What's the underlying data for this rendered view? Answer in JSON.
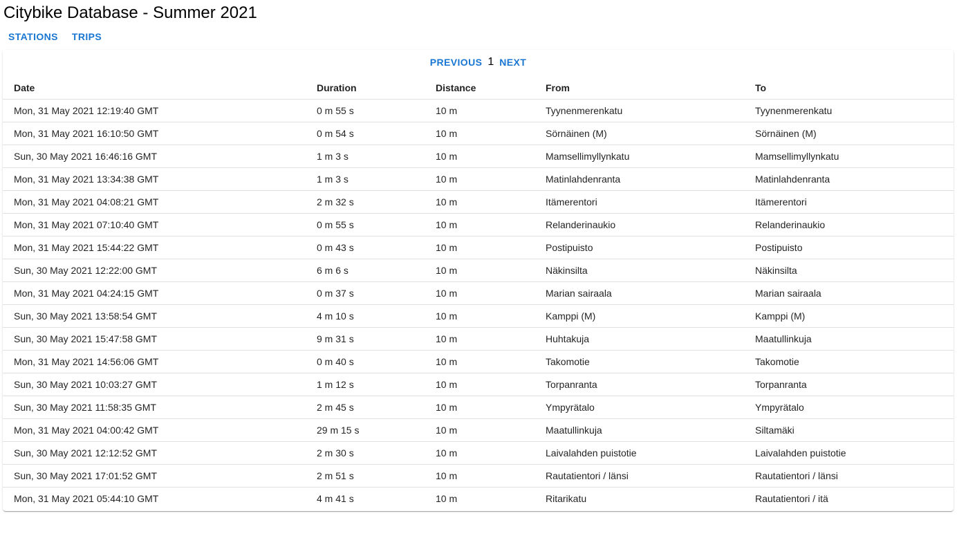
{
  "app": {
    "title": "Citybike Database - Summer 2021"
  },
  "nav": {
    "stations_label": "STATIONS",
    "trips_label": "TRIPS"
  },
  "pagination": {
    "previous_label": "PREVIOUS",
    "current_page": "1",
    "next_label": "NEXT"
  },
  "table": {
    "headers": {
      "date": "Date",
      "duration": "Duration",
      "distance": "Distance",
      "from": "From",
      "to": "To"
    },
    "rows": [
      {
        "date": "Mon, 31 May 2021 12:19:40 GMT",
        "duration": "0 m 55 s",
        "distance": "10 m",
        "from": "Tyynenmerenkatu",
        "to": "Tyynenmerenkatu"
      },
      {
        "date": "Mon, 31 May 2021 16:10:50 GMT",
        "duration": "0 m 54 s",
        "distance": "10 m",
        "from": "Sörnäinen (M)",
        "to": "Sörnäinen (M)"
      },
      {
        "date": "Sun, 30 May 2021 16:46:16 GMT",
        "duration": "1 m 3 s",
        "distance": "10 m",
        "from": "Mamsellimyllynkatu",
        "to": "Mamsellimyllynkatu"
      },
      {
        "date": "Mon, 31 May 2021 13:34:38 GMT",
        "duration": "1 m 3 s",
        "distance": "10 m",
        "from": "Matinlahdenranta",
        "to": "Matinlahdenranta"
      },
      {
        "date": "Mon, 31 May 2021 04:08:21 GMT",
        "duration": "2 m 32 s",
        "distance": "10 m",
        "from": "Itämerentori",
        "to": "Itämerentori"
      },
      {
        "date": "Mon, 31 May 2021 07:10:40 GMT",
        "duration": "0 m 55 s",
        "distance": "10 m",
        "from": "Relanderinaukio",
        "to": "Relanderinaukio"
      },
      {
        "date": "Mon, 31 May 2021 15:44:22 GMT",
        "duration": "0 m 43 s",
        "distance": "10 m",
        "from": "Postipuisto",
        "to": "Postipuisto"
      },
      {
        "date": "Sun, 30 May 2021 12:22:00 GMT",
        "duration": "6 m 6 s",
        "distance": "10 m",
        "from": "Näkinsilta",
        "to": "Näkinsilta"
      },
      {
        "date": "Mon, 31 May 2021 04:24:15 GMT",
        "duration": "0 m 37 s",
        "distance": "10 m",
        "from": "Marian sairaala",
        "to": "Marian sairaala"
      },
      {
        "date": "Sun, 30 May 2021 13:58:54 GMT",
        "duration": "4 m 10 s",
        "distance": "10 m",
        "from": "Kamppi (M)",
        "to": "Kamppi (M)"
      },
      {
        "date": "Sun, 30 May 2021 15:47:58 GMT",
        "duration": "9 m 31 s",
        "distance": "10 m",
        "from": "Huhtakuja",
        "to": "Maatullinkuja"
      },
      {
        "date": "Mon, 31 May 2021 14:56:06 GMT",
        "duration": "0 m 40 s",
        "distance": "10 m",
        "from": "Takomotie",
        "to": "Takomotie"
      },
      {
        "date": "Sun, 30 May 2021 10:03:27 GMT",
        "duration": "1 m 12 s",
        "distance": "10 m",
        "from": "Torpanranta",
        "to": "Torpanranta"
      },
      {
        "date": "Sun, 30 May 2021 11:58:35 GMT",
        "duration": "2 m 45 s",
        "distance": "10 m",
        "from": "Ympyrätalo",
        "to": "Ympyrätalo"
      },
      {
        "date": "Mon, 31 May 2021 04:00:42 GMT",
        "duration": "29 m 15 s",
        "distance": "10 m",
        "from": "Maatullinkuja",
        "to": "Siltamäki"
      },
      {
        "date": "Sun, 30 May 2021 12:12:52 GMT",
        "duration": "2 m 30 s",
        "distance": "10 m",
        "from": "Laivalahden puistotie",
        "to": "Laivalahden puistotie"
      },
      {
        "date": "Sun, 30 May 2021 17:01:52 GMT",
        "duration": "2 m 51 s",
        "distance": "10 m",
        "from": "Rautatientori / länsi",
        "to": "Rautatientori / länsi"
      },
      {
        "date": "Mon, 31 May 2021 05:44:10 GMT",
        "duration": "4 m 41 s",
        "distance": "10 m",
        "from": "Ritarikatu",
        "to": "Rautatientori / itä"
      }
    ]
  },
  "colors": {
    "accent": "#1976d2",
    "divider": "#e0e0e0",
    "text": "#212121"
  }
}
